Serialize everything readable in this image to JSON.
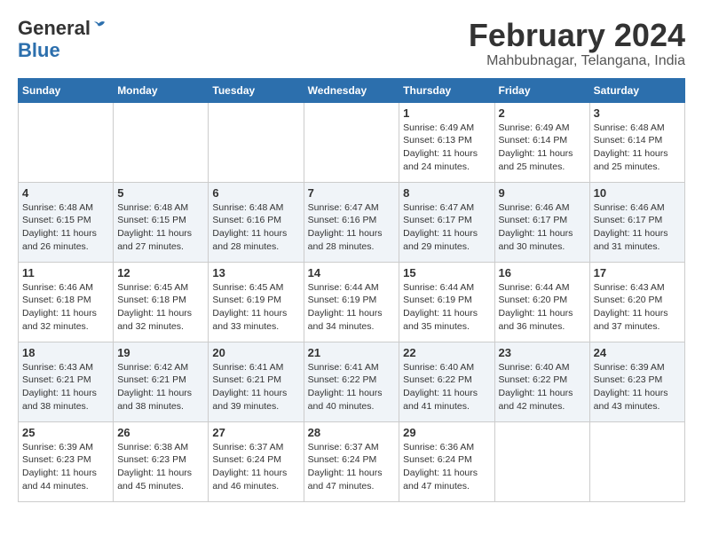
{
  "logo": {
    "general": "General",
    "blue": "Blue"
  },
  "title": "February 2024",
  "location": "Mahbubnagar, Telangana, India",
  "headers": [
    "Sunday",
    "Monday",
    "Tuesday",
    "Wednesday",
    "Thursday",
    "Friday",
    "Saturday"
  ],
  "weeks": [
    [
      {
        "day": "",
        "info": ""
      },
      {
        "day": "",
        "info": ""
      },
      {
        "day": "",
        "info": ""
      },
      {
        "day": "",
        "info": ""
      },
      {
        "day": "1",
        "info": "Sunrise: 6:49 AM\nSunset: 6:13 PM\nDaylight: 11 hours\nand 24 minutes."
      },
      {
        "day": "2",
        "info": "Sunrise: 6:49 AM\nSunset: 6:14 PM\nDaylight: 11 hours\nand 25 minutes."
      },
      {
        "day": "3",
        "info": "Sunrise: 6:48 AM\nSunset: 6:14 PM\nDaylight: 11 hours\nand 25 minutes."
      }
    ],
    [
      {
        "day": "4",
        "info": "Sunrise: 6:48 AM\nSunset: 6:15 PM\nDaylight: 11 hours\nand 26 minutes."
      },
      {
        "day": "5",
        "info": "Sunrise: 6:48 AM\nSunset: 6:15 PM\nDaylight: 11 hours\nand 27 minutes."
      },
      {
        "day": "6",
        "info": "Sunrise: 6:48 AM\nSunset: 6:16 PM\nDaylight: 11 hours\nand 28 minutes."
      },
      {
        "day": "7",
        "info": "Sunrise: 6:47 AM\nSunset: 6:16 PM\nDaylight: 11 hours\nand 28 minutes."
      },
      {
        "day": "8",
        "info": "Sunrise: 6:47 AM\nSunset: 6:17 PM\nDaylight: 11 hours\nand 29 minutes."
      },
      {
        "day": "9",
        "info": "Sunrise: 6:46 AM\nSunset: 6:17 PM\nDaylight: 11 hours\nand 30 minutes."
      },
      {
        "day": "10",
        "info": "Sunrise: 6:46 AM\nSunset: 6:17 PM\nDaylight: 11 hours\nand 31 minutes."
      }
    ],
    [
      {
        "day": "11",
        "info": "Sunrise: 6:46 AM\nSunset: 6:18 PM\nDaylight: 11 hours\nand 32 minutes."
      },
      {
        "day": "12",
        "info": "Sunrise: 6:45 AM\nSunset: 6:18 PM\nDaylight: 11 hours\nand 32 minutes."
      },
      {
        "day": "13",
        "info": "Sunrise: 6:45 AM\nSunset: 6:19 PM\nDaylight: 11 hours\nand 33 minutes."
      },
      {
        "day": "14",
        "info": "Sunrise: 6:44 AM\nSunset: 6:19 PM\nDaylight: 11 hours\nand 34 minutes."
      },
      {
        "day": "15",
        "info": "Sunrise: 6:44 AM\nSunset: 6:19 PM\nDaylight: 11 hours\nand 35 minutes."
      },
      {
        "day": "16",
        "info": "Sunrise: 6:44 AM\nSunset: 6:20 PM\nDaylight: 11 hours\nand 36 minutes."
      },
      {
        "day": "17",
        "info": "Sunrise: 6:43 AM\nSunset: 6:20 PM\nDaylight: 11 hours\nand 37 minutes."
      }
    ],
    [
      {
        "day": "18",
        "info": "Sunrise: 6:43 AM\nSunset: 6:21 PM\nDaylight: 11 hours\nand 38 minutes."
      },
      {
        "day": "19",
        "info": "Sunrise: 6:42 AM\nSunset: 6:21 PM\nDaylight: 11 hours\nand 38 minutes."
      },
      {
        "day": "20",
        "info": "Sunrise: 6:41 AM\nSunset: 6:21 PM\nDaylight: 11 hours\nand 39 minutes."
      },
      {
        "day": "21",
        "info": "Sunrise: 6:41 AM\nSunset: 6:22 PM\nDaylight: 11 hours\nand 40 minutes."
      },
      {
        "day": "22",
        "info": "Sunrise: 6:40 AM\nSunset: 6:22 PM\nDaylight: 11 hours\nand 41 minutes."
      },
      {
        "day": "23",
        "info": "Sunrise: 6:40 AM\nSunset: 6:22 PM\nDaylight: 11 hours\nand 42 minutes."
      },
      {
        "day": "24",
        "info": "Sunrise: 6:39 AM\nSunset: 6:23 PM\nDaylight: 11 hours\nand 43 minutes."
      }
    ],
    [
      {
        "day": "25",
        "info": "Sunrise: 6:39 AM\nSunset: 6:23 PM\nDaylight: 11 hours\nand 44 minutes."
      },
      {
        "day": "26",
        "info": "Sunrise: 6:38 AM\nSunset: 6:23 PM\nDaylight: 11 hours\nand 45 minutes."
      },
      {
        "day": "27",
        "info": "Sunrise: 6:37 AM\nSunset: 6:24 PM\nDaylight: 11 hours\nand 46 minutes."
      },
      {
        "day": "28",
        "info": "Sunrise: 6:37 AM\nSunset: 6:24 PM\nDaylight: 11 hours\nand 47 minutes."
      },
      {
        "day": "29",
        "info": "Sunrise: 6:36 AM\nSunset: 6:24 PM\nDaylight: 11 hours\nand 47 minutes."
      },
      {
        "day": "",
        "info": ""
      },
      {
        "day": "",
        "info": ""
      }
    ]
  ]
}
